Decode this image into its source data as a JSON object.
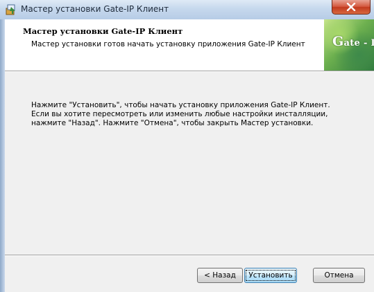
{
  "window": {
    "title": "Мастер установки Gate-IP Клиент",
    "title_icon": "installer-icon",
    "close_icon": "close-icon"
  },
  "header": {
    "title": "Мастер установки Gate-IP Клиент",
    "subtitle": "Мастер установки готов начать установку приложения Gate-IP Клиент",
    "logo_initial": "G",
    "logo_rest": "ate - IP"
  },
  "body": {
    "lines": [
      "Нажмите \"Установить\", чтобы начать установку приложения Gate-IP Клиент.",
      "Если вы хотите пересмотреть или изменить любые настройки инсталляции,",
      "нажмите \"Назад\". Нажмите \"Отмена\", чтобы закрыть Мастер установки."
    ]
  },
  "buttons": {
    "back_label": "< Назад",
    "install_label": "Установить",
    "cancel_label": "Отмена"
  },
  "colors": {
    "close_button": "#c94a2c",
    "default_button_border": "#3c7fb1",
    "logo_green": "#6db04f"
  }
}
